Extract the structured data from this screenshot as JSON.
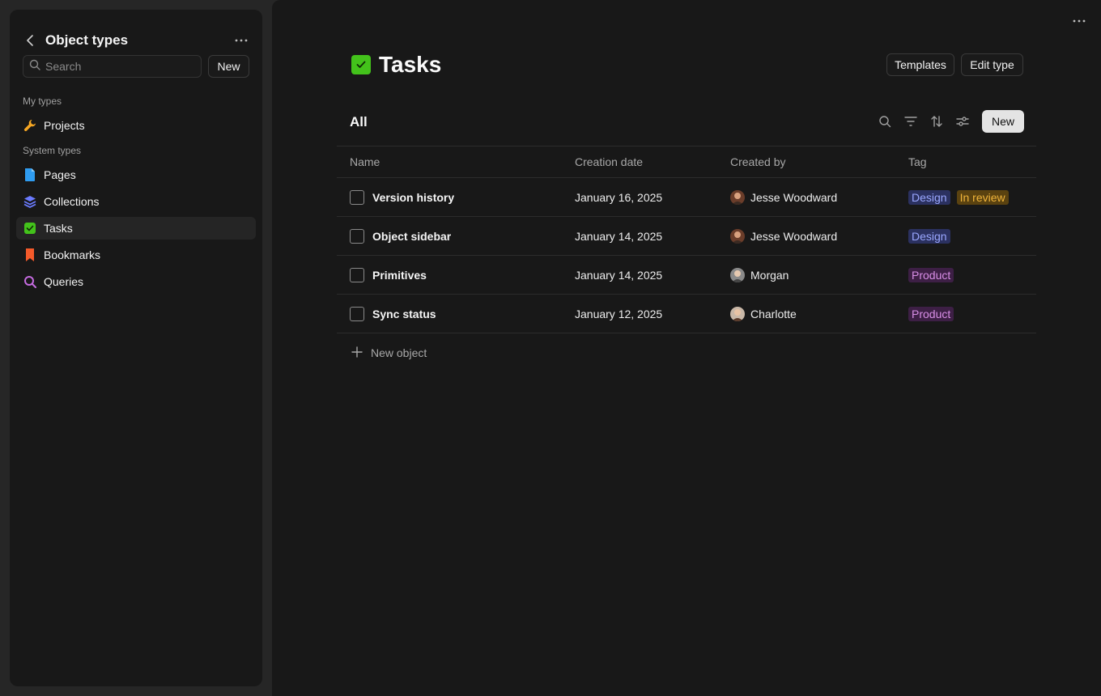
{
  "sidebar": {
    "title": "Object types",
    "search_placeholder": "Search",
    "new_label": "New",
    "my_types_label": "My types",
    "system_types_label": "System types",
    "my_items": [
      {
        "label": "Projects",
        "icon": "wrench-icon"
      }
    ],
    "system_items": [
      {
        "label": "Pages",
        "icon": "page-icon"
      },
      {
        "label": "Collections",
        "icon": "layers-icon"
      },
      {
        "label": "Tasks",
        "icon": "checkbox-icon",
        "active": true
      },
      {
        "label": "Bookmarks",
        "icon": "bookmark-icon"
      },
      {
        "label": "Queries",
        "icon": "search-icon"
      }
    ]
  },
  "page": {
    "title": "Tasks",
    "templates_label": "Templates",
    "edit_type_label": "Edit type",
    "view_title": "All",
    "new_label": "New",
    "new_object_label": "New object"
  },
  "table": {
    "columns": [
      "Name",
      "Creation date",
      "Created by",
      "Tag"
    ],
    "rows": [
      {
        "name": "Version history",
        "date": "January 16, 2025",
        "by": "Jesse Woodward",
        "tags": [
          "Design",
          "In review"
        ]
      },
      {
        "name": "Object sidebar",
        "date": "January 14, 2025",
        "by": "Jesse Woodward",
        "tags": [
          "Design"
        ]
      },
      {
        "name": "Primitives",
        "date": "January 14, 2025",
        "by": "Morgan",
        "tags": [
          "Product"
        ]
      },
      {
        "name": "Sync status",
        "date": "January 12, 2025",
        "by": "Charlotte",
        "tags": [
          "Product"
        ]
      }
    ]
  },
  "colors": {
    "tag_design_bg": "#2b3160",
    "tag_design_fg": "#9aa7ff",
    "tag_review_bg": "#5a4210",
    "tag_review_fg": "#f0b43a",
    "tag_product_bg": "#3d1f45",
    "tag_product_fg": "#d88ee6",
    "accent_green": "#43c21b"
  }
}
